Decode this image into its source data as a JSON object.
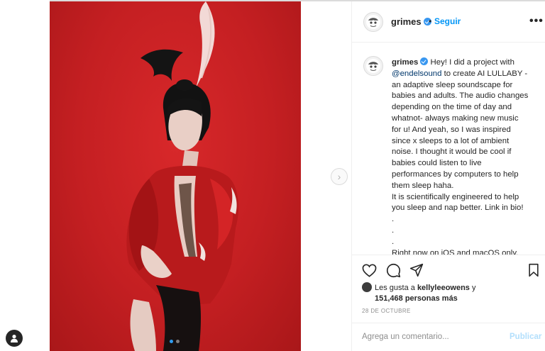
{
  "post": {
    "username": "grimes",
    "follow_label": "Seguir",
    "separator": "•",
    "more_label": "•••",
    "caption_lines": [
      "Hey! I did a project with",
      "@endelsound",
      " to create AI LULLABY -\nan adaptive sleep soundscape for\nbabies and adults. The audio changes\ndepending on the time of day and\nwhatnot- always making new music\nfor u! And yeah, so I was inspired\nsince x sleeps to a lot of ambient\nnoise. I thought it would be cool if\nbabies could listen to live\nperformances by computers to help\nthem sleep haha.\nIt is scientifically engineered to help\nyou sleep and nap better. Link in bio!\n.\n.\n.\nRight now on iOS and macOS only,\nother platforms later this year."
    ],
    "likes_prefix": "Les gusta a",
    "likes_user": "kellyleeowens",
    "likes_conjunction": "y",
    "likes_count": "151,468 personas más",
    "date": "28 DE OCTUBRE",
    "comment_placeholder": "Agrega un comentario...",
    "publish_label": "Publicar"
  },
  "carousel": {
    "total": 2,
    "active_index": 0,
    "next_arrow": "›"
  },
  "icons": {
    "verified": "verified-badge-icon",
    "like": "heart-icon",
    "comment": "comment-bubble-icon",
    "share": "paper-plane-icon",
    "save": "bookmark-icon",
    "profile": "profile-icon",
    "next": "chevron-right-icon"
  },
  "colors": {
    "background_red": "#c41f22",
    "accent_blue": "#0095f6",
    "verified_blue": "#3897f0",
    "muted_text": "#8e8e8e",
    "publish_disabled": "#b2dffc"
  }
}
